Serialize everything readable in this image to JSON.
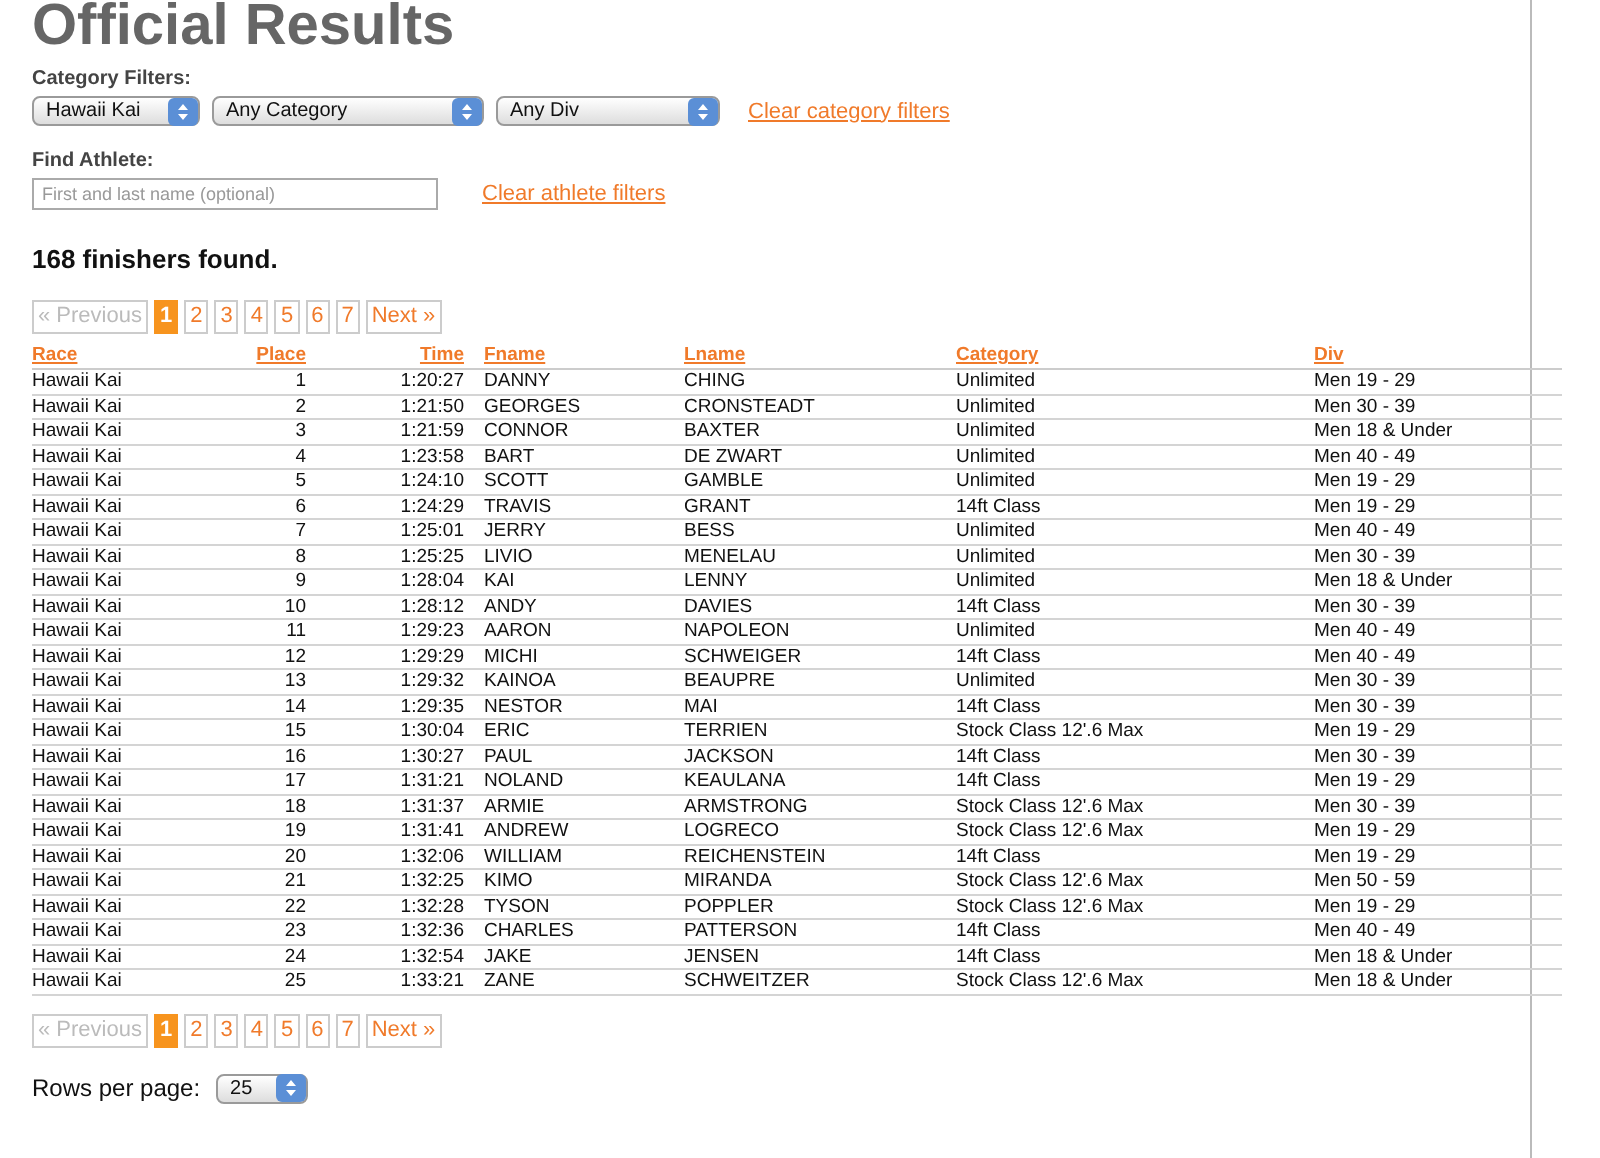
{
  "page_title": "Official Results",
  "category_filters": {
    "label": "Category Filters:",
    "dropdowns": [
      {
        "value": "Hawaii Kai",
        "kind": "short"
      },
      {
        "value": "Any Category",
        "kind": "wide"
      },
      {
        "value": "Any Div",
        "kind": "medium"
      }
    ],
    "clear_link": "Clear category filters"
  },
  "find_athlete": {
    "label": "Find Athlete:",
    "placeholder": "First and last name (optional)",
    "clear_link": "Clear athlete filters"
  },
  "summary": "168 finishers found.",
  "pagination_top": {
    "previous": {
      "label": "« Previous",
      "disabled": true
    },
    "pages": [
      {
        "label": "1",
        "selected": true
      },
      {
        "label": "2",
        "selected": false
      },
      {
        "label": "3",
        "selected": false
      },
      {
        "label": "4",
        "selected": false
      },
      {
        "label": "5",
        "selected": false
      },
      {
        "label": "6",
        "selected": false
      },
      {
        "label": "7",
        "selected": false
      }
    ],
    "next": {
      "label": "Next »",
      "disabled": false
    }
  },
  "table": {
    "columns": [
      "Race",
      "Place",
      "Time",
      "Fname",
      "Lname",
      "Category",
      "Div"
    ],
    "rows": [
      [
        "Hawaii Kai",
        "1",
        "1:20:27",
        "DANNY",
        "CHING",
        "Unlimited",
        "Men 19 - 29"
      ],
      [
        "Hawaii Kai",
        "2",
        "1:21:50",
        "GEORGES",
        "CRONSTEADT",
        "Unlimited",
        "Men 30 - 39"
      ],
      [
        "Hawaii Kai",
        "3",
        "1:21:59",
        "CONNOR",
        "BAXTER",
        "Unlimited",
        "Men 18 & Under"
      ],
      [
        "Hawaii Kai",
        "4",
        "1:23:58",
        "BART",
        "DE ZWART",
        "Unlimited",
        "Men 40 - 49"
      ],
      [
        "Hawaii Kai",
        "5",
        "1:24:10",
        "SCOTT",
        "GAMBLE",
        "Unlimited",
        "Men 19 - 29"
      ],
      [
        "Hawaii Kai",
        "6",
        "1:24:29",
        "TRAVIS",
        "GRANT",
        "14ft Class",
        "Men 19 - 29"
      ],
      [
        "Hawaii Kai",
        "7",
        "1:25:01",
        "JERRY",
        "BESS",
        "Unlimited",
        "Men 40 - 49"
      ],
      [
        "Hawaii Kai",
        "8",
        "1:25:25",
        "LIVIO",
        "MENELAU",
        "Unlimited",
        "Men 30 - 39"
      ],
      [
        "Hawaii Kai",
        "9",
        "1:28:04",
        "KAI",
        "LENNY",
        "Unlimited",
        "Men 18 & Under"
      ],
      [
        "Hawaii Kai",
        "10",
        "1:28:12",
        "ANDY",
        "DAVIES",
        "14ft Class",
        "Men 30 - 39"
      ],
      [
        "Hawaii Kai",
        "11",
        "1:29:23",
        "AARON",
        "NAPOLEON",
        "Unlimited",
        "Men 40 - 49"
      ],
      [
        "Hawaii Kai",
        "12",
        "1:29:29",
        "MICHI",
        "SCHWEIGER",
        "14ft Class",
        "Men 40 - 49"
      ],
      [
        "Hawaii Kai",
        "13",
        "1:29:32",
        "KAINOA",
        "BEAUPRE",
        "Unlimited",
        "Men 30 - 39"
      ],
      [
        "Hawaii Kai",
        "14",
        "1:29:35",
        "NESTOR",
        "MAI",
        "14ft Class",
        "Men 30 - 39"
      ],
      [
        "Hawaii Kai",
        "15",
        "1:30:04",
        "ERIC",
        "TERRIEN",
        "Stock Class 12'.6 Max",
        "Men 19 - 29"
      ],
      [
        "Hawaii Kai",
        "16",
        "1:30:27",
        "PAUL",
        "JACKSON",
        "14ft Class",
        "Men 30 - 39"
      ],
      [
        "Hawaii Kai",
        "17",
        "1:31:21",
        "NOLAND",
        "KEAULANA",
        "14ft Class",
        "Men 19 - 29"
      ],
      [
        "Hawaii Kai",
        "18",
        "1:31:37",
        "ARMIE",
        "ARMSTRONG",
        "Stock Class 12'.6 Max",
        "Men 30 - 39"
      ],
      [
        "Hawaii Kai",
        "19",
        "1:31:41",
        "ANDREW",
        "LOGRECO",
        "Stock Class 12'.6 Max",
        "Men 19 - 29"
      ],
      [
        "Hawaii Kai",
        "20",
        "1:32:06",
        "WILLIAM",
        "REICHENSTEIN",
        "14ft Class",
        "Men 19 - 29"
      ],
      [
        "Hawaii Kai",
        "21",
        "1:32:25",
        "KIMO",
        "MIRANDA",
        "Stock Class 12'.6 Max",
        "Men 50 - 59"
      ],
      [
        "Hawaii Kai",
        "22",
        "1:32:28",
        "TYSON",
        "POPPLER",
        "Stock Class 12'.6 Max",
        "Men 19 - 29"
      ],
      [
        "Hawaii Kai",
        "23",
        "1:32:36",
        "CHARLES",
        "PATTERSON",
        "14ft Class",
        "Men 40 - 49"
      ],
      [
        "Hawaii Kai",
        "24",
        "1:32:54",
        "JAKE",
        "JENSEN",
        "14ft Class",
        "Men 18 & Under"
      ],
      [
        "Hawaii Kai",
        "25",
        "1:33:21",
        "ZANE",
        "SCHWEITZER",
        "Stock Class 12'.6 Max",
        "Men 18 & Under"
      ]
    ]
  },
  "pagination_bottom": {
    "previous": {
      "label": "« Previous",
      "disabled": true
    },
    "pages": [
      {
        "label": "1",
        "selected": true
      },
      {
        "label": "2",
        "selected": false
      },
      {
        "label": "3",
        "selected": false
      },
      {
        "label": "4",
        "selected": false
      },
      {
        "label": "5",
        "selected": false
      },
      {
        "label": "6",
        "selected": false
      },
      {
        "label": "7",
        "selected": false
      }
    ],
    "next": {
      "label": "Next »",
      "disabled": false
    }
  },
  "rows_per_page": {
    "label": "Rows per page:",
    "value": "25"
  }
}
